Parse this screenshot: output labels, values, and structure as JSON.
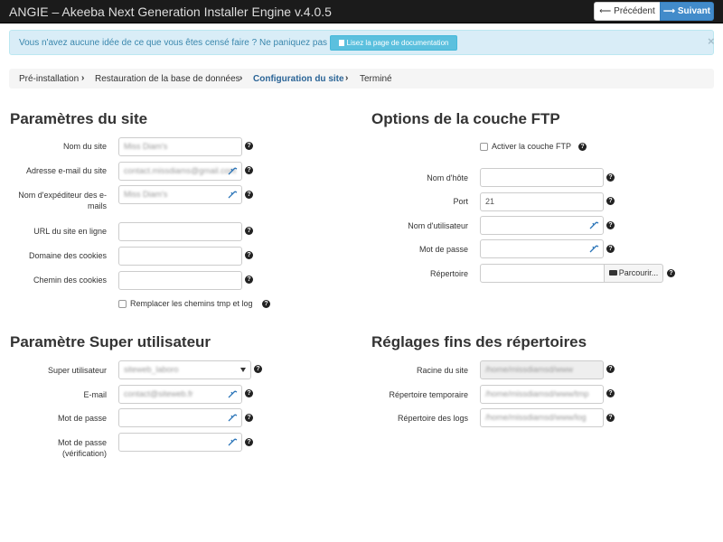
{
  "header": {
    "title": "ANGIE – Akeeba Next Generation Installer Engine v.4.0.5",
    "prev_label": "Précédent",
    "next_label": "Suivant"
  },
  "alert": {
    "text": "Vous n'avez aucune idée de ce que vous êtes censé faire ? Ne paniquez pas !",
    "button": "Lisez la page de documentation",
    "close": "×"
  },
  "breadcrumb": [
    "Pré-installation",
    "Restauration de la base de données",
    "Configuration du site",
    "Terminé"
  ],
  "site": {
    "title": "Paramètres du site",
    "name_label": "Nom du site",
    "name_value": "Miss Diam's",
    "email_label": "Adresse e-mail du site",
    "email_value": "contact.missdiams@gmail.com",
    "sender_label": "Nom d'expéditeur des e-mails",
    "sender_value": "Miss Diam's",
    "url_label": "URL du site en ligne",
    "cookie_domain_label": "Domaine des cookies",
    "cookie_path_label": "Chemin des cookies",
    "replace_label": "Remplacer les chemins tmp et log"
  },
  "ftp": {
    "title": "Options de la couche FTP",
    "enable_label": "Activer la couche FTP",
    "host_label": "Nom d'hôte",
    "port_label": "Port",
    "port_value": "21",
    "user_label": "Nom d'utilisateur",
    "pass_label": "Mot de passe",
    "dir_label": "Répertoire",
    "browse_label": "Parcourir..."
  },
  "superuser": {
    "title": "Paramètre Super utilisateur",
    "user_label": "Super utilisateur",
    "user_value": "siteweb_laboro",
    "email_label": "E-mail",
    "email_value": "contact@siteweb.fr",
    "pass_label": "Mot de passe",
    "pass2_label": "Mot de passe (vérification)"
  },
  "dirs": {
    "title": "Réglages fins des répertoires",
    "root_label": "Racine du site",
    "root_value": "/home/missdiamsd/www",
    "tmp_label": "Répertoire temporaire",
    "tmp_value": "/home/missdiamsd/www/tmp",
    "log_label": "Répertoire des logs",
    "log_value": "/home/missdiamsd/www/log"
  },
  "help_glyph": "?",
  "icons": {
    "prev": "arrow-left-icon",
    "next": "arrow-right-icon",
    "doc": "book-icon",
    "key": "key-icon",
    "help": "question-circle-icon",
    "browse": "folder-open-icon"
  },
  "colors": {
    "topbar": "#1b1b1b",
    "primary": "#428bca",
    "info_bg": "#d9edf7",
    "info_button": "#5bc0de",
    "breadcrumb_active": "#2a6496"
  }
}
